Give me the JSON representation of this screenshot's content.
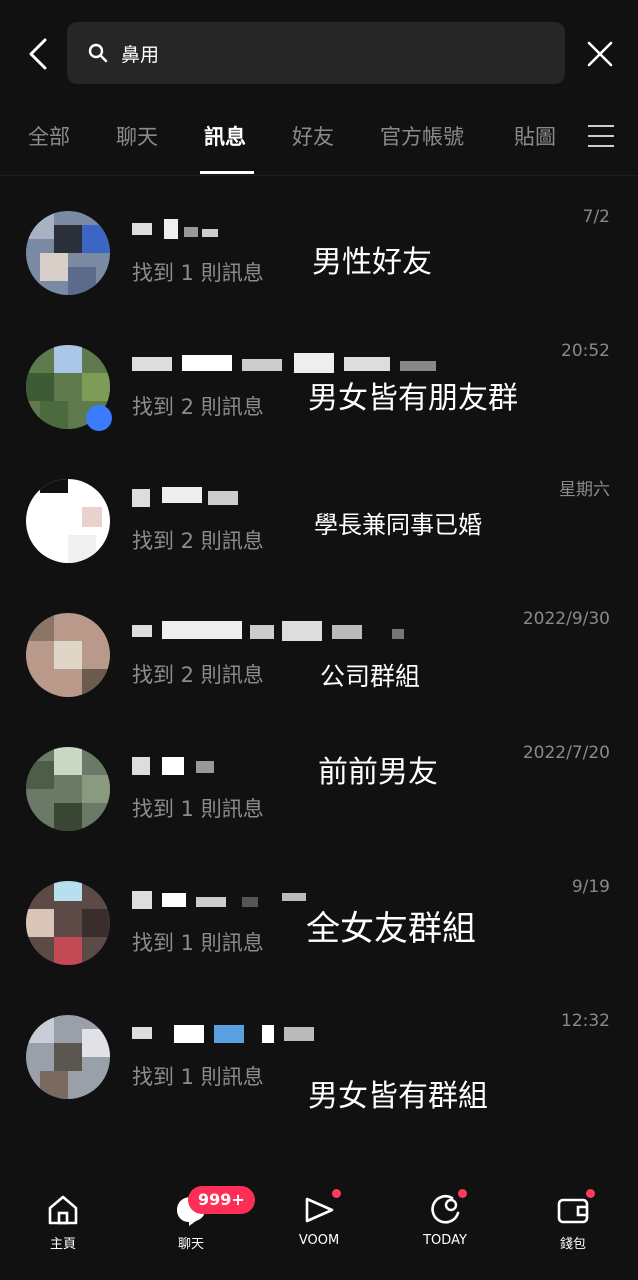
{
  "search": {
    "query": "鼻用"
  },
  "tabs": [
    "全部",
    "聊天",
    "訊息",
    "好友",
    "官方帳號",
    "貼圖"
  ],
  "active_tab": "訊息",
  "results": [
    {
      "time": "7/2",
      "meta": "找到 1 則訊息",
      "note": "男性好友"
    },
    {
      "time": "20:52",
      "meta": "找到 2 則訊息",
      "note": "男女皆有朋友群"
    },
    {
      "time": "星期六",
      "meta": "找到 2 則訊息",
      "note": "學長兼同事已婚"
    },
    {
      "time": "2022/9/30",
      "meta": "找到 2 則訊息",
      "note": "公司群組"
    },
    {
      "time": "2022/7/20",
      "meta": "找到 1 則訊息",
      "note": "前前男友"
    },
    {
      "time": "9/19",
      "meta": "找到 1 則訊息",
      "note": "全女友群組"
    },
    {
      "time": "12:32",
      "meta": "找到 1 則訊息",
      "note": "男女皆有群組"
    }
  ],
  "bottom_nav": {
    "home": "主頁",
    "chat": "聊天",
    "chat_badge": "999+",
    "voom": "VOOM",
    "today": "TODAY",
    "wallet": "錢包"
  },
  "colors": {
    "background": "#111111",
    "badge": "#ff2e56",
    "muted_text": "#8c8c8c"
  }
}
